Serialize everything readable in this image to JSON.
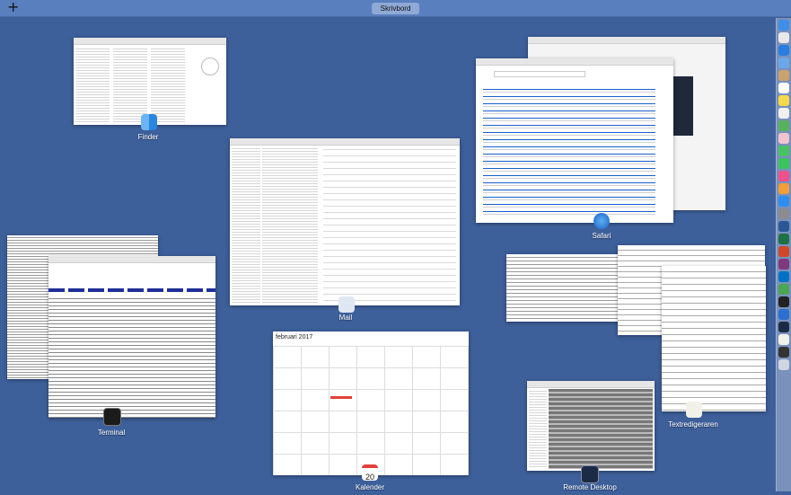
{
  "topbar": {
    "add_label": "+",
    "space_name": "Skrivbord"
  },
  "windows": {
    "finder": {
      "label": "Finder"
    },
    "mail": {
      "label": "Mail"
    },
    "safari": {
      "label": "Safari"
    },
    "terminal": {
      "label": "Terminal"
    },
    "kalender": {
      "label": "Kalender",
      "month_title": "februari 2017",
      "day_number": "20"
    },
    "remote_desktop": {
      "label": "Remote Desktop"
    },
    "textredigeraren": {
      "label": "Textredigeraren"
    }
  },
  "colors": {
    "desktop": "#3d5f9a",
    "topbar": "#5a7fbf",
    "safari_blue": "#1a5fc8",
    "calendar_red": "#e2403a"
  },
  "dock": {
    "icons": [
      "finder-icon",
      "launchpad-icon",
      "safari-icon",
      "mail-icon",
      "contacts-icon",
      "calendar-icon",
      "notes-icon",
      "reminders-icon",
      "maps-icon",
      "photos-icon",
      "messages-icon",
      "facetime-icon",
      "itunes-icon",
      "ibooks-icon",
      "appstore-icon",
      "system-preferences-icon",
      "word-icon",
      "excel-icon",
      "powerpoint-icon",
      "onenote-icon",
      "outlook-icon",
      "chrome-icon",
      "terminal-icon",
      "xcode-icon",
      "remote-desktop-icon",
      "textedit-icon",
      "activity-monitor-icon",
      "trash-icon"
    ]
  }
}
